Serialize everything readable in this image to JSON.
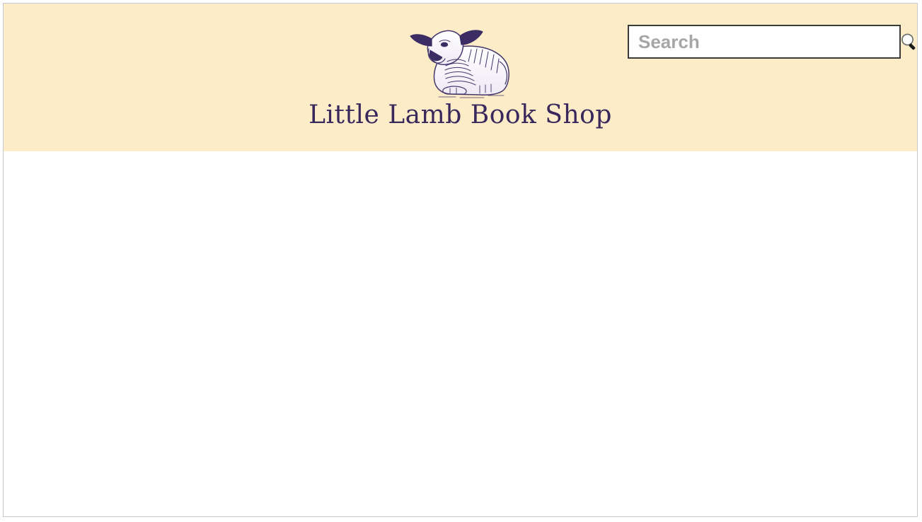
{
  "page": {
    "background_color": "#ffffff",
    "frame_border_color": "#c8c8cc"
  },
  "header": {
    "background_color": "#fdecc8",
    "brand": {
      "title": "Little Lamb Book Shop",
      "title_color": "#39285c",
      "logo_icon": "lamb-engraving-icon",
      "logo_ink_color": "#44366b"
    }
  },
  "search": {
    "value": "",
    "placeholder": "Search",
    "placeholder_color": "#a6a6a6",
    "border_color": "#3a3a3a",
    "background_color": "#ffffff",
    "icon": "magnifying-glass-icon",
    "button_label": "Search"
  },
  "main": {
    "background_color": "#ffffff",
    "content": ""
  }
}
